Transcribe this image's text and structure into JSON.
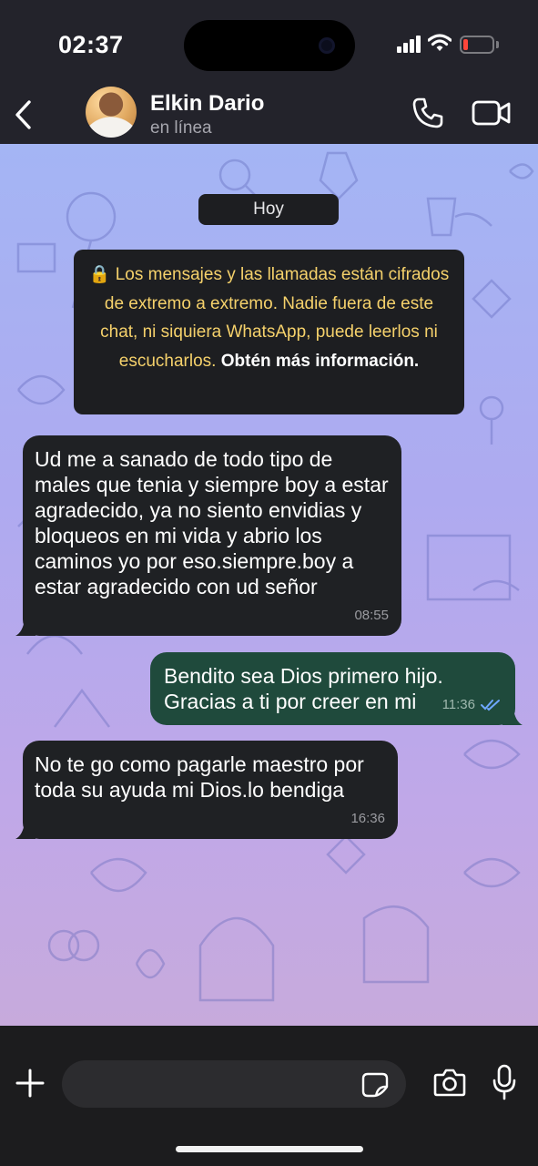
{
  "status_bar": {
    "time": "02:37",
    "battery_level": 0.15,
    "battery_color": "#ff453a"
  },
  "header": {
    "contact_name": "Elkin Dario",
    "contact_status": "en línea"
  },
  "chat": {
    "date_chip": "Hoy",
    "encryption_notice": {
      "text": "Los mensajes y las llamadas están cifrados de extremo a extremo. Nadie fuera de este chat, ni siquiera WhatsApp, puede leerlos ni escucharlos.",
      "link": "Obtén más información.",
      "text_color": "#f5d16b"
    },
    "messages": [
      {
        "direction": "incoming",
        "text": "Ud me a sanado de todo tipo de males que tenia y siempre boy a estar agradecido, ya no siento envidias y bloqueos en mi vida y abrio los caminos yo por eso.siempre.boy a estar agradecido con ud señor",
        "time": "08:55"
      },
      {
        "direction": "outgoing",
        "text": "Bendito sea Dios primero hijo. Gracias a ti por creer en mi",
        "time": "11:36",
        "status": "read"
      },
      {
        "direction": "incoming",
        "text": "No te go como pagarle maestro por toda su ayuda mi Dios.lo bendiga",
        "time": "16:36"
      }
    ]
  },
  "composer": {
    "placeholder": ""
  },
  "colors": {
    "incoming_bubble": "#1f2124",
    "outgoing_bubble": "#1f4a3c",
    "read_ticks": "#6fa8ff"
  }
}
